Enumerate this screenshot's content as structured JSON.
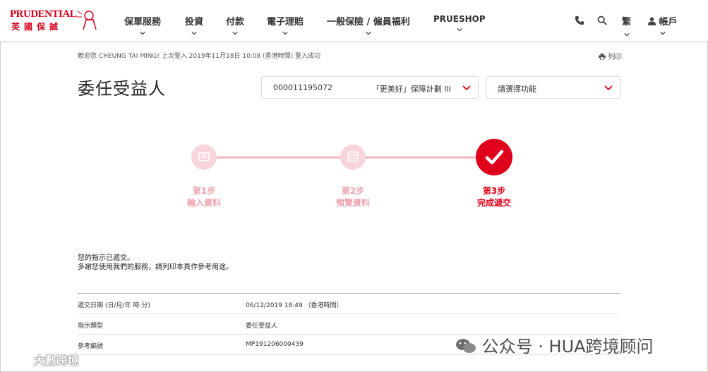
{
  "header": {
    "logo_brand": "PRUDENTIAL",
    "logo_cn": "英國保誠",
    "nav": [
      "保單服務",
      "投資",
      "付款",
      "電子理賠",
      "一般保險 / 僱員福利",
      "PRUESHOP"
    ],
    "lang": "繁",
    "account": "帳戶"
  },
  "login_info": "歡迎您 CHEUNG TAI MING! 上次登入 2019年11月18日 10:08 (香港時間) 登入成功",
  "print_label": "列印",
  "page_title": "委任受益人",
  "policy_select": {
    "number": "000011195072",
    "plan": "「更美好」保障計劃 III"
  },
  "function_select": {
    "placeholder": "請選擇功能"
  },
  "steps": [
    {
      "title": "第1步",
      "desc": "輸入資料"
    },
    {
      "title": "第2步",
      "desc": "預覽資料"
    },
    {
      "title": "第3步",
      "desc": "完成遞交"
    }
  ],
  "message": {
    "line1": "您的指示已遞交。",
    "line2": "多謝您使用我們的服務，請列印本頁作參考用途。"
  },
  "details": [
    {
      "label": "遞交日期 (日/月/年 時:分)",
      "value": "06/12/2019 18:49 （香港時間）"
    },
    {
      "label": "指示類型",
      "value": "委任受益人"
    },
    {
      "label": "參考編號",
      "value": "MP191206000439"
    }
  ],
  "watermark": "公众号 · HUA跨境顾问",
  "watermark2": "大數跨境",
  "colors": {
    "brand_red": "#e0001b",
    "step_inactive": "#f8d5da"
  }
}
